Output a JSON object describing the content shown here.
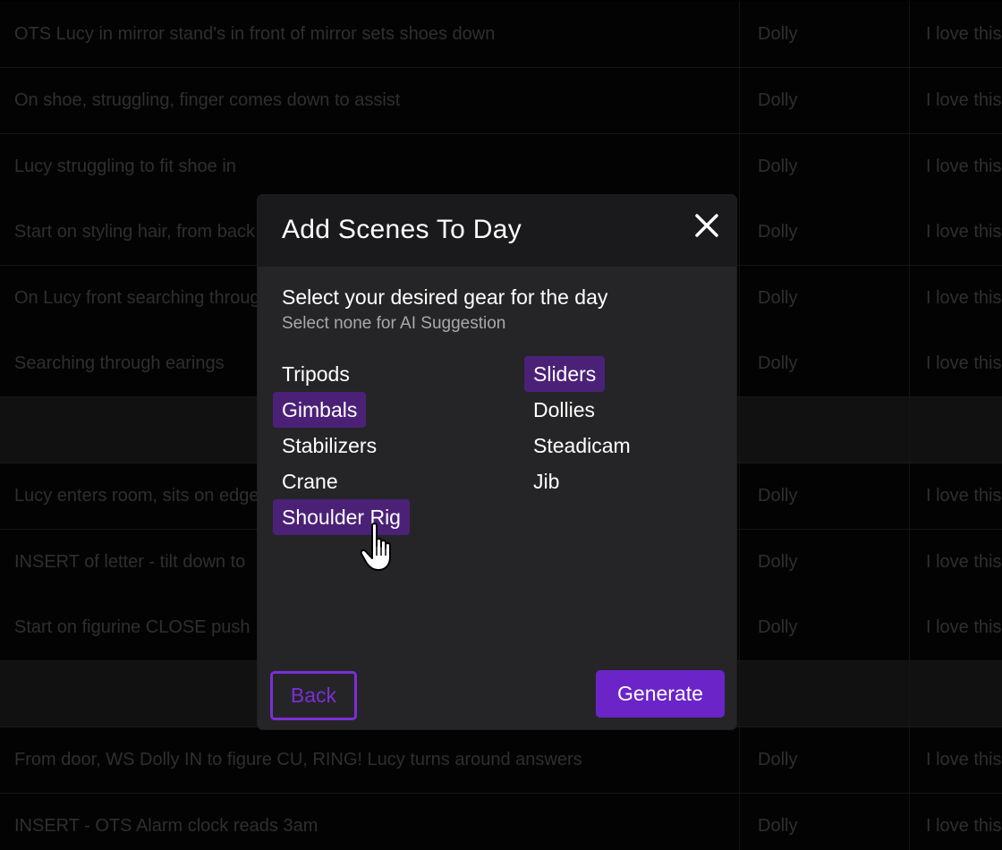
{
  "background_table": {
    "rows": [
      {
        "description": "OTS Lucy in mirror stand's in front of mirror sets shoes down",
        "gear": "Dolly",
        "note": "I love this"
      },
      {
        "description": "On shoe, struggling, finger comes down to assist",
        "gear": "Dolly",
        "note": "I love this"
      },
      {
        "description": "Lucy struggling to fit shoe in",
        "gear": "Dolly",
        "note": "I love this"
      },
      {
        "description": "Start on styling hair, from back",
        "gear": "Dolly",
        "note": "I love this"
      },
      {
        "description": "On Lucy front searching through",
        "gear": "Dolly",
        "note": "I love this"
      },
      {
        "description": "Searching through earings",
        "gear": "Dolly",
        "note": "I love this"
      },
      {
        "description": "",
        "gear": "",
        "note": ""
      },
      {
        "description": "Lucy enters room, sits on edge",
        "gear": "Dolly",
        "note": "I love this"
      },
      {
        "description": "INSERT of letter - tilt down to",
        "gear": "Dolly",
        "note": "I love this"
      },
      {
        "description": "Start on figurine CLOSE push",
        "gear": "Dolly",
        "note": "I love this"
      },
      {
        "description": "",
        "gear": "",
        "note": ""
      },
      {
        "description": "From door, WS Dolly IN to figure CU, RING! Lucy turns around answers",
        "gear": "Dolly",
        "note": "I love this"
      },
      {
        "description": "INSERT - OTS Alarm clock reads 3am",
        "gear": "Dolly",
        "note": "I love this"
      }
    ]
  },
  "modal": {
    "title": "Add Scenes To Day",
    "close_icon": "close-icon",
    "subtitle": "Select your desired gear for the day",
    "hint": "Select none for AI Suggestion",
    "gear_left": [
      {
        "label": "Tripods",
        "selected": false
      },
      {
        "label": "Gimbals",
        "selected": true
      },
      {
        "label": "Stabilizers",
        "selected": false
      },
      {
        "label": "Crane",
        "selected": false
      },
      {
        "label": "Shoulder Rig",
        "selected": true
      }
    ],
    "gear_right": [
      {
        "label": "Sliders",
        "selected": true
      },
      {
        "label": "Dollies",
        "selected": false
      },
      {
        "label": "Steadicam",
        "selected": false
      },
      {
        "label": "Jib",
        "selected": false
      }
    ],
    "back_label": "Back",
    "generate_label": "Generate"
  },
  "colors": {
    "accent": "#6b24c8",
    "selected_bg": "#4b2178",
    "modal_bg": "#252527",
    "header_bg": "#1a1a1c"
  },
  "cursor_icon": "hand-pointer-icon"
}
